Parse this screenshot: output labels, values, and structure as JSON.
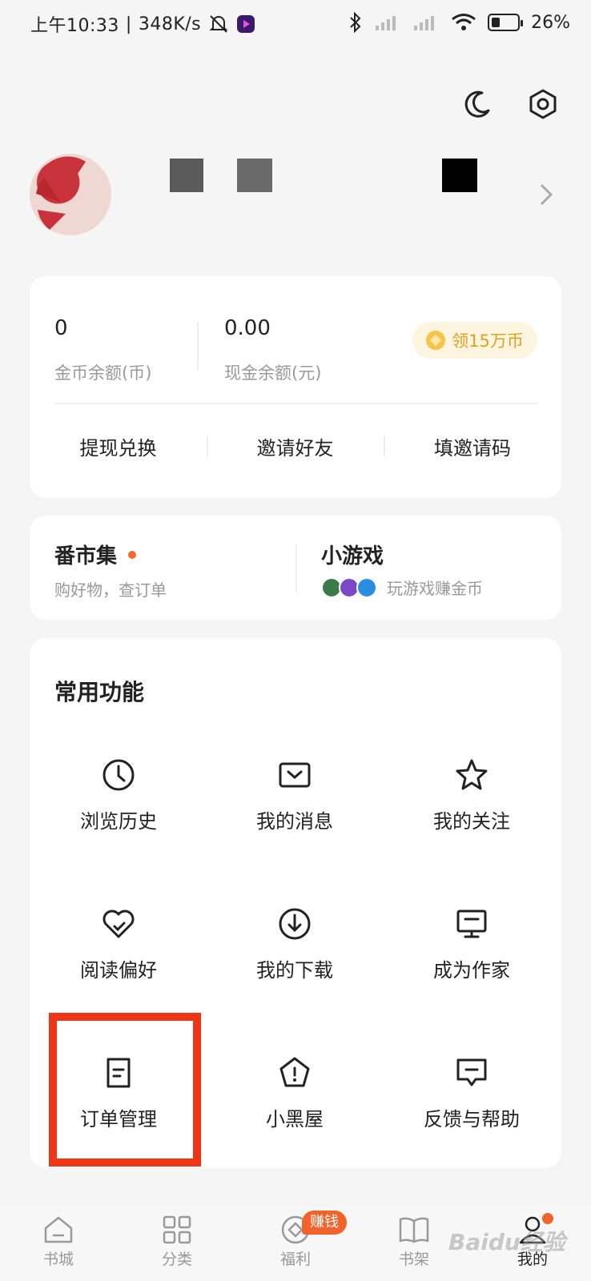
{
  "status_bar": {
    "time": "上午10:33",
    "speed": "348K/s",
    "battery": "26%"
  },
  "balance": {
    "coins_value": "0",
    "coins_label": "金币余额(币)",
    "cash_value": "0.00",
    "cash_label": "现金余额(元)",
    "promo": "领15万币",
    "actions": [
      "提现兑换",
      "邀请好友",
      "填邀请码"
    ]
  },
  "mall": {
    "title": "番市集",
    "subtitle": "购好物，查订单"
  },
  "games": {
    "title": "小游戏",
    "subtitle": "玩游戏赚金币"
  },
  "functions": {
    "title": "常用功能",
    "items": [
      {
        "label": "浏览历史",
        "icon": "clock-icon"
      },
      {
        "label": "我的消息",
        "icon": "message-icon"
      },
      {
        "label": "我的关注",
        "icon": "star-icon"
      },
      {
        "label": "阅读偏好",
        "icon": "heart-check-icon"
      },
      {
        "label": "我的下载",
        "icon": "download-icon"
      },
      {
        "label": "成为作家",
        "icon": "monitor-icon"
      },
      {
        "label": "订单管理",
        "icon": "document-icon"
      },
      {
        "label": "小黑屋",
        "icon": "pentagon-alert-icon"
      },
      {
        "label": "反馈与帮助",
        "icon": "chat-feedback-icon"
      }
    ]
  },
  "bottom_nav": {
    "items": [
      "书城",
      "分类",
      "福利",
      "书架",
      "我的"
    ],
    "earn_badge": "赚钱",
    "active": "我的"
  },
  "watermark": "Baidu经验",
  "colors": {
    "accent": "#f2622a",
    "highlight": "#ee3616",
    "coin": "#e0a11d"
  }
}
